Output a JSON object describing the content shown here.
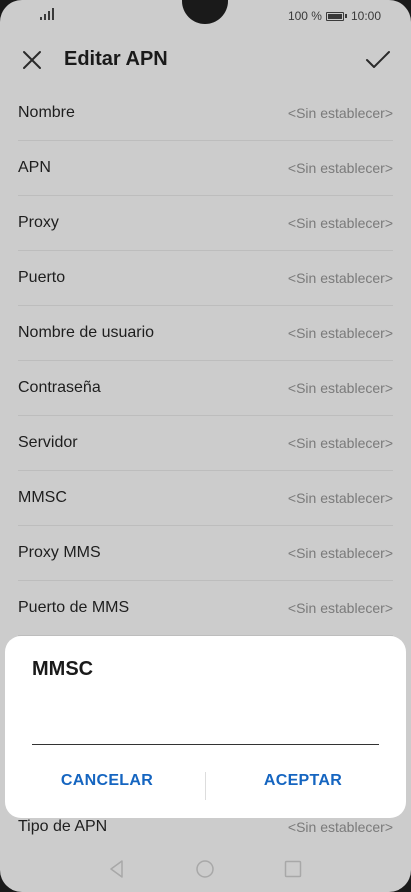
{
  "status": {
    "battery_text": "100 %",
    "time": "10:00"
  },
  "header": {
    "title": "Editar APN"
  },
  "rows": [
    {
      "label": "Nombre",
      "value": "<Sin establecer>"
    },
    {
      "label": "APN",
      "value": "<Sin establecer>"
    },
    {
      "label": "Proxy",
      "value": "<Sin establecer>"
    },
    {
      "label": "Puerto",
      "value": "<Sin establecer>"
    },
    {
      "label": "Nombre de usuario",
      "value": "<Sin establecer>"
    },
    {
      "label": "Contraseña",
      "value": "<Sin establecer>"
    },
    {
      "label": "Servidor",
      "value": "<Sin establecer>"
    },
    {
      "label": "MMSC",
      "value": "<Sin establecer>"
    },
    {
      "label": "Proxy MMS",
      "value": "<Sin establecer>"
    },
    {
      "label": "Puerto de MMS",
      "value": "<Sin establecer>"
    }
  ],
  "last_row": {
    "label": "Tipo de APN",
    "value": "<Sin establecer>"
  },
  "dialog": {
    "title": "MMSC",
    "input_value": "",
    "cancel_label": "CANCELAR",
    "accept_label": "ACEPTAR"
  },
  "colors": {
    "accent": "#1565c0",
    "background": "#cccccc",
    "dialog": "#ffffff"
  },
  "icons": {
    "close": "close-icon",
    "check": "check-icon",
    "nav_back": "nav-back-icon",
    "nav_home": "nav-home-icon",
    "nav_recent": "nav-recent-icon"
  }
}
